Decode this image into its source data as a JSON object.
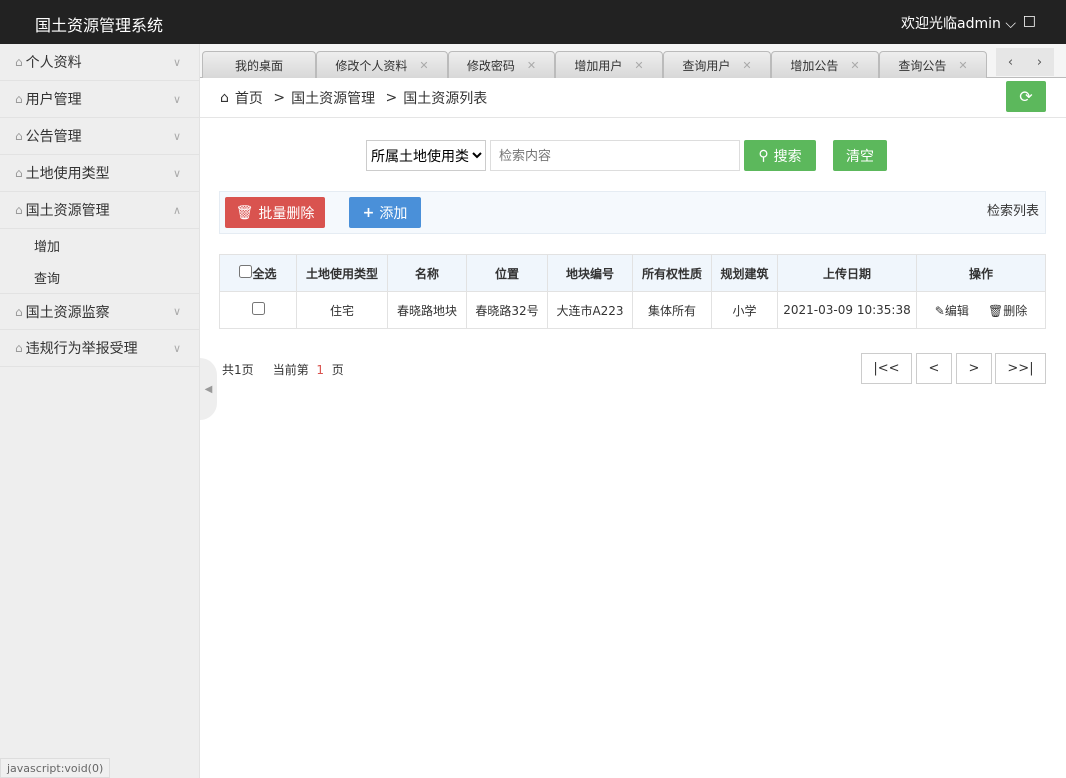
{
  "header": {
    "title": "国土资源管理系统",
    "user": "欢迎光临admin",
    "user_chevron": "⌄",
    "shirt": "👕"
  },
  "sidebar": {
    "items": [
      {
        "label": "个人资料",
        "expanded": false
      },
      {
        "label": "用户管理",
        "expanded": false
      },
      {
        "label": "公告管理",
        "expanded": false
      },
      {
        "label": "土地使用类型",
        "expanded": false
      },
      {
        "label": "国土资源管理",
        "expanded": true,
        "children": [
          "增加",
          "查询"
        ]
      },
      {
        "label": "国土资源监察",
        "expanded": false
      },
      {
        "label": "违规行为举报受理",
        "expanded": false
      }
    ]
  },
  "tabs": [
    "我的桌面",
    "修改个人资料",
    "修改密码",
    "增加用户",
    "查询用户",
    "增加公告",
    "查询公告"
  ],
  "breadcrumb": [
    "首页",
    "国土资源管理",
    "国土资源列表"
  ],
  "search": {
    "select": "所属土地使用类",
    "placeholder": "检索内容",
    "search_label": "搜索",
    "clear_label": "清空"
  },
  "toolbar": {
    "batch_delete": "批量删除",
    "add": "添加",
    "title": "检索列表"
  },
  "table": {
    "select_all": "全选",
    "headers": [
      "土地使用类型",
      "名称",
      "位置",
      "地块编号",
      "所有权性质",
      "规划建筑",
      "上传日期",
      "操作"
    ],
    "rows": [
      {
        "cells": [
          "住宅",
          "春晓路地块",
          "春晓路32号",
          "大连市A223",
          "集体所有",
          "小学",
          "2021-03-09 10:35:38"
        ],
        "edit": "编辑",
        "delete": "删除"
      }
    ]
  },
  "pagination": {
    "total_prefix": "共",
    "total": "1",
    "total_suffix": "页",
    "current_prefix": "当前第",
    "current": "1",
    "current_suffix": "页",
    "first": "|<<",
    "prev": "<",
    "next": ">",
    "last": ">>|"
  },
  "status_bar": "javascript:void(0)",
  "colors": {
    "green": "#5cb85c",
    "red": "#d9534f",
    "blue": "#4a90d9",
    "header": "#222222"
  }
}
